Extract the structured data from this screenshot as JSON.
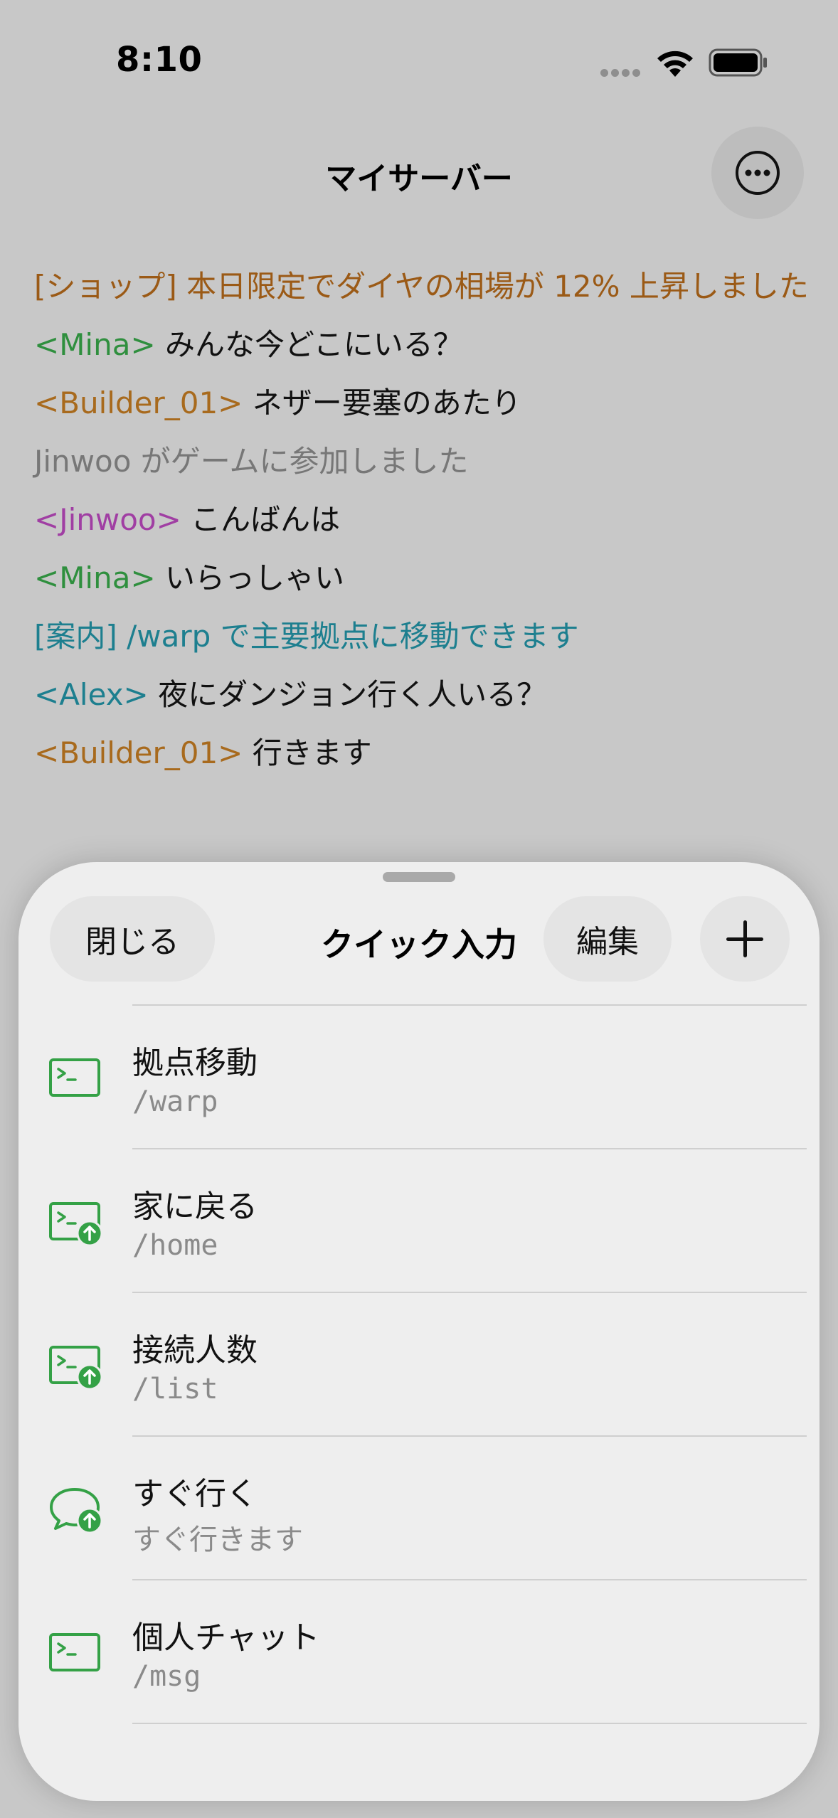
{
  "status_bar": {
    "time": "8:10"
  },
  "header": {
    "title": "マイサーバー",
    "more_icon": "ellipsis-circle-icon"
  },
  "chat": [
    {
      "type": "notice",
      "text": "[ショップ] 本日限定でダイヤの相場が 12% 上昇しました",
      "color": "#9b5a16"
    },
    {
      "type": "message",
      "user": "<Mina>",
      "text": "みんな今どこにいる？",
      "user_color": "#2f8f3e"
    },
    {
      "type": "message",
      "user": "<Builder_01>",
      "text": "ネザー要塞のあたり",
      "user_color": "#a86a1d"
    },
    {
      "type": "system",
      "text": "Jinwoo がゲームに参加しました",
      "color": "#777777"
    },
    {
      "type": "message",
      "user": "<Jinwoo>",
      "text": "こんばんは",
      "user_color": "#a03ea3"
    },
    {
      "type": "message",
      "user": "<Mina>",
      "text": "いらっしゃい",
      "user_color": "#2f8f3e"
    },
    {
      "type": "notice",
      "text": "[案内] /warp で主要拠点に移動できます",
      "color": "#1d7f8f"
    },
    {
      "type": "message",
      "user": "<Alex>",
      "text": "夜にダンジョン行く人いる？",
      "user_color": "#1d7f8f"
    },
    {
      "type": "message",
      "user": "<Builder_01>",
      "text": "行きます",
      "user_color": "#a86a1d"
    }
  ],
  "sheet": {
    "close_label": "閉じる",
    "title": "クイック入力",
    "edit_label": "編集",
    "add_icon": "plus-icon",
    "items": [
      {
        "title": "拠点移動",
        "subtitle": "/warp",
        "icon": "terminal-icon",
        "badge": false
      },
      {
        "title": "家に戻る",
        "subtitle": "/home",
        "icon": "terminal-send-icon",
        "badge": true
      },
      {
        "title": "接続人数",
        "subtitle": "/list",
        "icon": "terminal-send-icon",
        "badge": true
      },
      {
        "title": "すぐ行く",
        "subtitle": "すぐ行きます",
        "icon": "message-send-icon",
        "badge": true
      },
      {
        "title": "個人チャット",
        "subtitle": "/msg",
        "icon": "terminal-icon",
        "badge": false
      }
    ]
  },
  "colors": {
    "accent_green": "#34a146"
  }
}
